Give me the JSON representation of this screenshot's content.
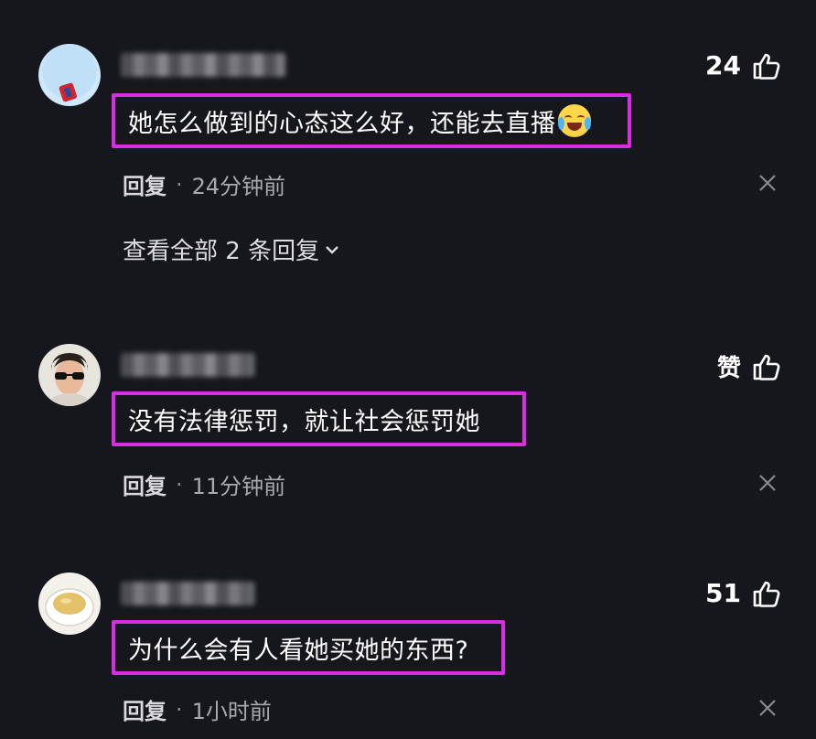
{
  "comments": [
    {
      "likes": "24",
      "text": "她怎么做到的心态这么好，还能去直播",
      "reply_label": "回复",
      "separator": "·",
      "time": "24分钟前",
      "view_replies": "查看全部 2 条回复"
    },
    {
      "likes": "赞",
      "text": "没有法律惩罚，就让社会惩罚她",
      "reply_label": "回复",
      "separator": "·",
      "time": "11分钟前"
    },
    {
      "likes": "51",
      "text": "为什么会有人看她买她的东西?",
      "reply_label": "回复",
      "separator": "·",
      "time": "1小时前"
    }
  ],
  "icons": {
    "like": "thumbs-up-icon",
    "close": "close-icon",
    "expand": "chevron-down-icon",
    "emoji": "crying-laughing-emoji"
  },
  "colors": {
    "background": "#16161d",
    "highlight_border": "#d62ee0",
    "meta_text": "#a9a9b0"
  }
}
